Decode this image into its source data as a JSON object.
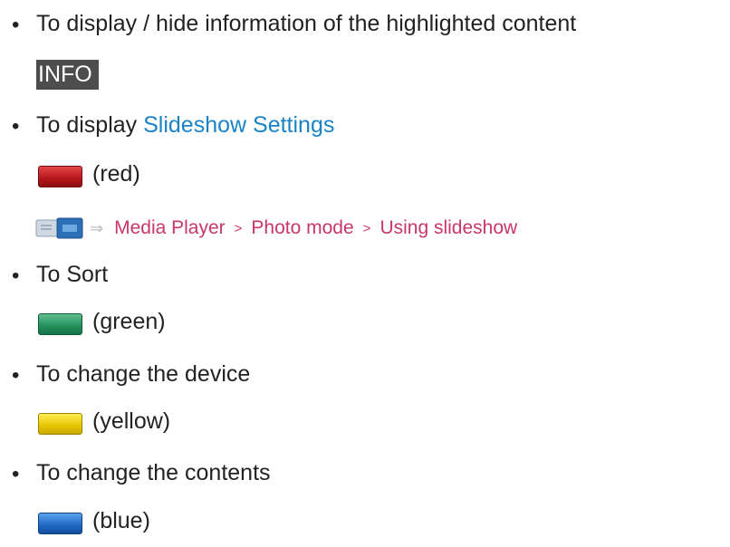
{
  "items": [
    {
      "bullet": "•",
      "text": "To display / hide information of the highlighted content"
    },
    {
      "bullet": "•",
      "text_prefix": "To display ",
      "link": "Slideshow Settings"
    },
    {
      "bullet": "•",
      "text": "To Sort"
    },
    {
      "bullet": "•",
      "text": "To change the device"
    },
    {
      "bullet": "•",
      "text": "To change the contents"
    }
  ],
  "info_key": {
    "label": "INFO",
    "color": "#4d4d4d"
  },
  "color_keys": [
    {
      "label": "(red)",
      "color": "#b4161b"
    },
    {
      "label": "(green)",
      "color": "#24905a"
    },
    {
      "label": "(yellow)",
      "color": "#e6c400"
    },
    {
      "label": "(blue)",
      "color": "#1f68c4"
    }
  ],
  "reference": {
    "icon": "emanual-reference-icon",
    "arrow": "⇒",
    "separator": ">",
    "path": [
      "Media Player",
      "Photo mode",
      "Using slideshow"
    ],
    "color": "#c8366b"
  },
  "link_color": "#1a83c6"
}
